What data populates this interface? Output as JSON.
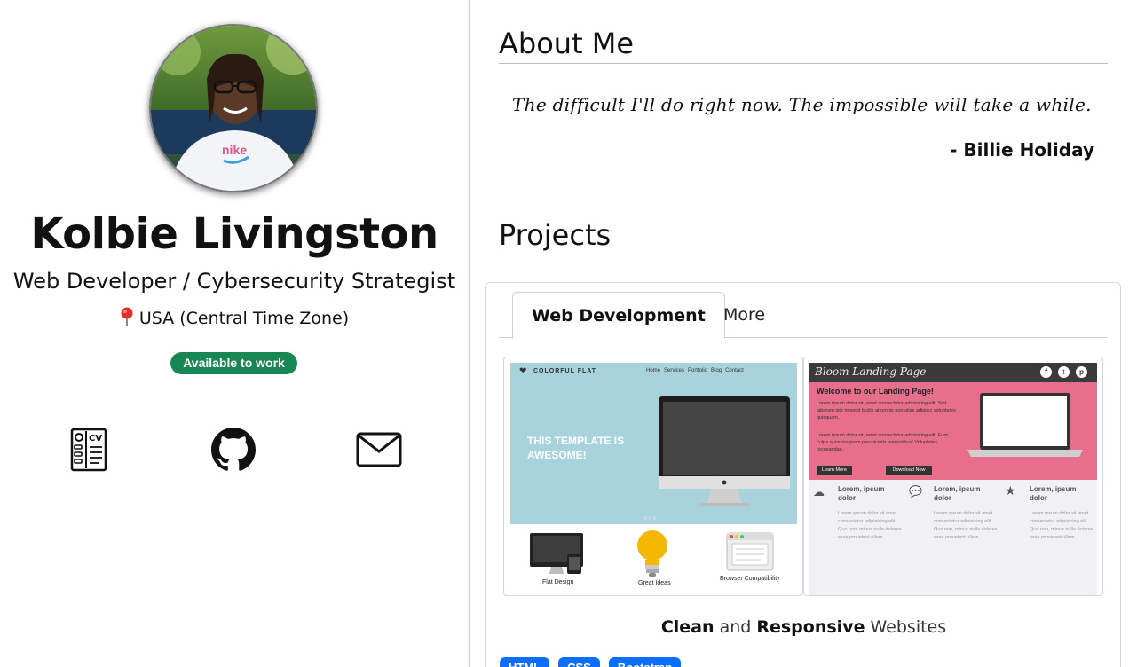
{
  "profile": {
    "name": "Kolbie Livingston",
    "role": "Web Developer / Cybersecurity Strategist",
    "location": "USA (Central Time Zone)",
    "availability": "Available to work",
    "badge_color": "#198754",
    "links": [
      {
        "icon": "cv-icon",
        "label": "CV"
      },
      {
        "icon": "github-icon",
        "label": "GitHub"
      },
      {
        "icon": "mail-icon",
        "label": "Email"
      }
    ]
  },
  "about": {
    "title": "About Me",
    "quote": "The difficult I'll do right now. The impossible will take a while.",
    "author": "- Billie Holiday"
  },
  "projects": {
    "title": "Projects",
    "tabs": [
      {
        "label": "Web Development",
        "active": true
      },
      {
        "label": "More",
        "active": false
      }
    ],
    "thumb1": {
      "brand": "COLORFUL FLAT",
      "nav": [
        "Home",
        "Services",
        "Portfolio",
        "Blog",
        "Contact"
      ],
      "hero_line1": "THIS TEMPLATE IS",
      "hero_line2": "AWESOME!",
      "features": [
        "Flat Design",
        "Great Ideas",
        "Browser Compatibility"
      ],
      "hero_color": "#a8d3dc"
    },
    "thumb2": {
      "brand": "Bloom Landing Page",
      "welcome": "Welcome to our Landing Page!",
      "body1": "Lorem ipsum dolor sit, amet consectetur adipisicing elit. Sint laborum iste impedit facilis at omnis non alias adipisci voluptates quisquam.",
      "body2": "Lorem ipsum dolor sit, amet consectetur adipisicing elit. Eum culpa quos magnam perspiciatis temporibus! Voluptates, recusandae.",
      "btn_learn": "Learn More",
      "btn_download": "Download Now",
      "col_heading": "Lorem, ipsum dolor",
      "col_text": "Lorem ipsum dolor sit amet consectetur adipisicing elit. Quo non, minus nulla dolores esse provident ullam.",
      "hero_color": "#e86f8c"
    },
    "caption_bold1": "Clean",
    "caption_mid": " and ",
    "caption_bold2": "Responsive",
    "caption_end": " Websites",
    "tags": [
      "HTML",
      "CSS",
      "Bootstrap"
    ],
    "tag_color": "#0d6efd"
  }
}
